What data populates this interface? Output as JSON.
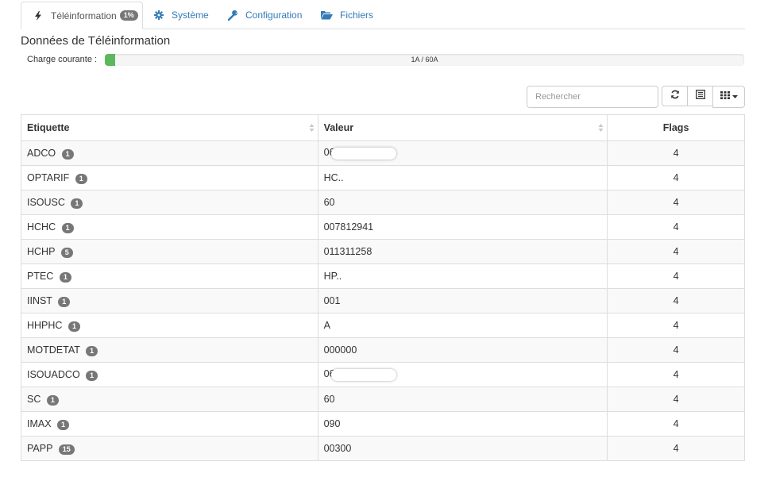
{
  "tabs": [
    {
      "label": "Téléinformation",
      "badge": "1%",
      "icon": "bolt-icon"
    },
    {
      "label": "Système",
      "icon": "gear-icon"
    },
    {
      "label": "Configuration",
      "icon": "wrench-icon"
    },
    {
      "label": "Fichiers",
      "icon": "folder-open-icon"
    }
  ],
  "page": {
    "title": "Données de Téléinformation"
  },
  "charge": {
    "label": "Charge courante :",
    "text": "1A / 60A",
    "fraction": 0.0167
  },
  "toolbar": {
    "search_placeholder": "Rechercher"
  },
  "colors": {
    "accent": "#337ab7",
    "progress": "#5cb85c",
    "badge": "#777777"
  },
  "table": {
    "headers": {
      "label": "Etiquette",
      "value": "Valeur",
      "flags": "Flags"
    },
    "rows": [
      {
        "label": "ADCO",
        "count": "1",
        "value": "06",
        "flags": "4"
      },
      {
        "label": "OPTARIF",
        "count": "1",
        "value": "HC..",
        "flags": "4"
      },
      {
        "label": "ISOUSC",
        "count": "1",
        "value": "60",
        "flags": "4"
      },
      {
        "label": "HCHC",
        "count": "1",
        "value": "007812941",
        "flags": "4"
      },
      {
        "label": "HCHP",
        "count": "5",
        "value": "011311258",
        "flags": "4"
      },
      {
        "label": "PTEC",
        "count": "1",
        "value": "HP..",
        "flags": "4"
      },
      {
        "label": "IINST",
        "count": "1",
        "value": "001",
        "flags": "4"
      },
      {
        "label": "HHPHC",
        "count": "1",
        "value": "A",
        "flags": "4"
      },
      {
        "label": "MOTDETAT",
        "count": "1",
        "value": "000000",
        "flags": "4"
      },
      {
        "label": "ISOUADCO",
        "count": "1",
        "value": "06",
        "flags": "4"
      },
      {
        "label": "SC",
        "count": "1",
        "value": "60",
        "flags": "4"
      },
      {
        "label": "IMAX",
        "count": "1",
        "value": "090",
        "flags": "4"
      },
      {
        "label": "PAPP",
        "count": "15",
        "value": "00300",
        "flags": "4"
      }
    ]
  }
}
